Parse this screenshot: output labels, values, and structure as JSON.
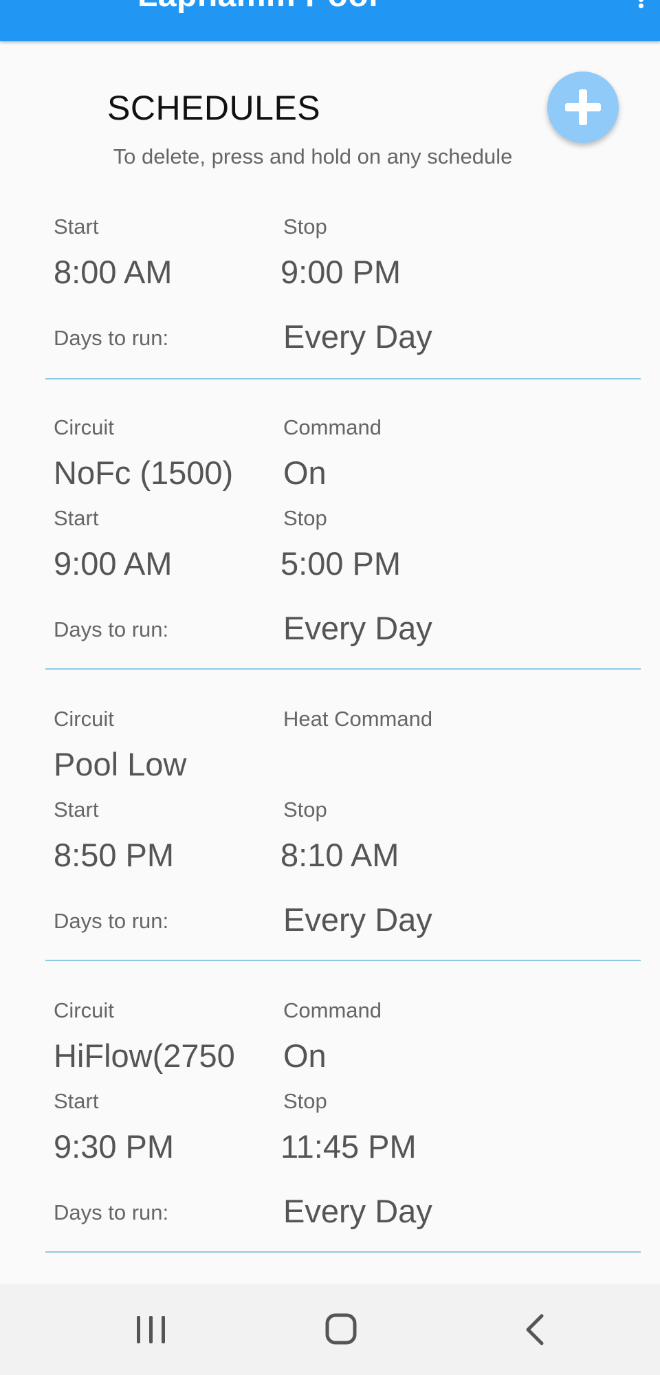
{
  "appbar": {
    "title": "Laphamm Pool",
    "menu_icon": "more-vert-icon",
    "color": "#2196f3"
  },
  "page": {
    "title": "SCHEDULES",
    "subtitle": "To delete, press and hold on any schedule",
    "add_icon": "add-icon",
    "add_button_color": "#90caf9"
  },
  "schedules": [
    {
      "start_label": "Start",
      "start": "8:00 AM",
      "stop_label": "Stop",
      "stop": "9:00 PM",
      "days_label": "Days to run:",
      "days": "Every Day"
    },
    {
      "circuit_label": "Circuit",
      "circuit": "NoFc (1500)",
      "command_label": "Command",
      "command": "On",
      "start_label": "Start",
      "start": "9:00 AM",
      "stop_label": "Stop",
      "stop": "5:00 PM",
      "days_label": "Days to run:",
      "days": "Every Day"
    },
    {
      "circuit_label": "Circuit",
      "circuit": "Pool Low",
      "command_label": "Heat Command",
      "command": "",
      "start_label": "Start",
      "start": "8:50 PM",
      "stop_label": "Stop",
      "stop": "8:10 AM",
      "days_label": "Days to run:",
      "days": "Every Day"
    },
    {
      "circuit_label": "Circuit",
      "circuit": "HiFlow(2750",
      "command_label": "Command",
      "command": "On",
      "start_label": "Start",
      "start": "9:30 PM",
      "stop_label": "Stop",
      "stop": "11:45 PM",
      "days_label": "Days to run:",
      "days": "Every Day"
    }
  ],
  "navbar": {
    "recents_icon": "recent-apps-icon",
    "home_icon": "home-icon",
    "back_icon": "back-icon"
  },
  "colors": {
    "divider": "#8ec9e6",
    "background": "#fafafa"
  }
}
